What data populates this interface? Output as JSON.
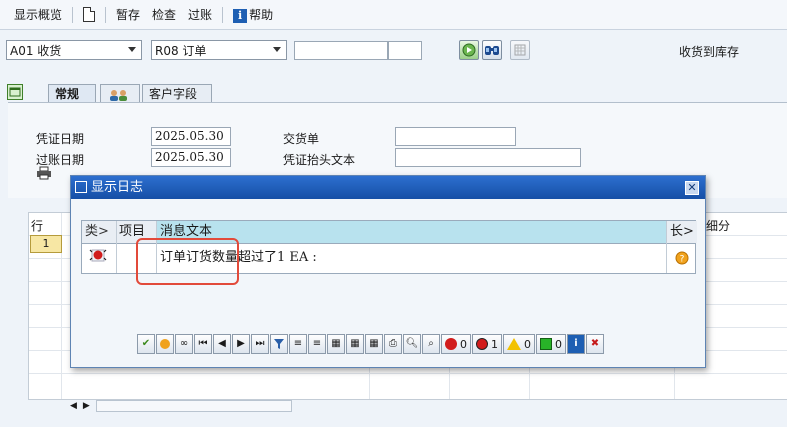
{
  "menubar": {
    "display_overview": "显示概览",
    "hold": "暂存",
    "check": "检查",
    "post": "过账",
    "help": "帮助",
    "help_icon_letter": "i"
  },
  "header": {
    "transaction_select": "A01 收货",
    "reference_select": "R08 订单",
    "movement_text": "收货到库存"
  },
  "tabs": [
    "常规",
    "供应商",
    "客户字段"
  ],
  "general": {
    "doc_date_label": "凭证日期",
    "doc_date_value": "2025.05.30",
    "posting_date_label": "过账日期",
    "posting_date_value": "2025.05.30",
    "delivery_note_label": "交货单",
    "header_text_label": "凭证抬头文本"
  },
  "grid": {
    "col_row": "行",
    "row_number": "1",
    "col_detail": "细分"
  },
  "dialog": {
    "title": "显示日志",
    "columns": [
      "类>",
      "项目",
      "消息文本",
      "长>"
    ],
    "rows": [
      {
        "type_icon": "error-icon",
        "item": "",
        "message": "订单订货数量超过了1 EA :",
        "long_text_icon": "question-icon"
      }
    ],
    "counters": {
      "stop": "0",
      "error": "1",
      "warning": "0",
      "success": "0"
    }
  },
  "colors": {
    "title_bar": "#1f5fbf",
    "highlight_box": "#e24a3a",
    "header_band": "#b8e2ee"
  }
}
